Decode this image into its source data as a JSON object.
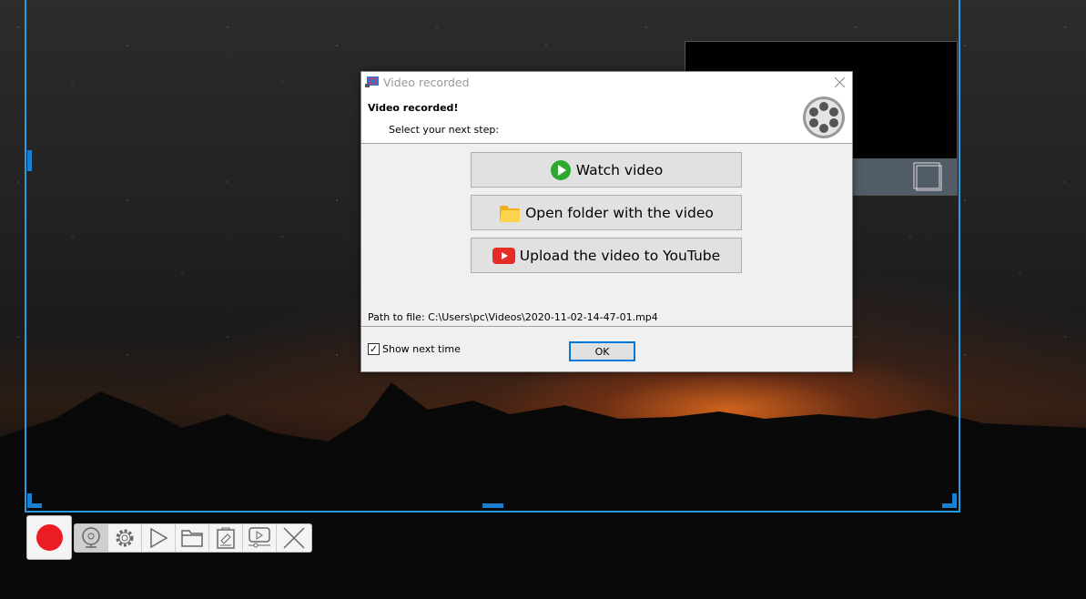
{
  "dialog": {
    "title": "Video recorded",
    "heading": "Video recorded!",
    "subheading": "Select your next step:",
    "buttons": [
      {
        "label": "Watch video",
        "icon": "play-circle-icon"
      },
      {
        "label": "Open folder with the video",
        "icon": "folder-icon"
      },
      {
        "label": "Upload the video to YouTube",
        "icon": "youtube-icon"
      }
    ],
    "path": "Path to file: C:\\Users\\pc\\Videos\\2020-11-02-14-47-01.mp4",
    "show_next_time": {
      "label": "Show next time",
      "checked": true
    },
    "ok_label": "OK"
  },
  "toolbar": {
    "items": [
      "record",
      "webcam",
      "settings",
      "play",
      "folder",
      "edit",
      "youtube-upload",
      "close"
    ]
  },
  "colors": {
    "frame": "#2a9be0",
    "record": "#ec1c24",
    "ok_border": "#0078d7"
  }
}
